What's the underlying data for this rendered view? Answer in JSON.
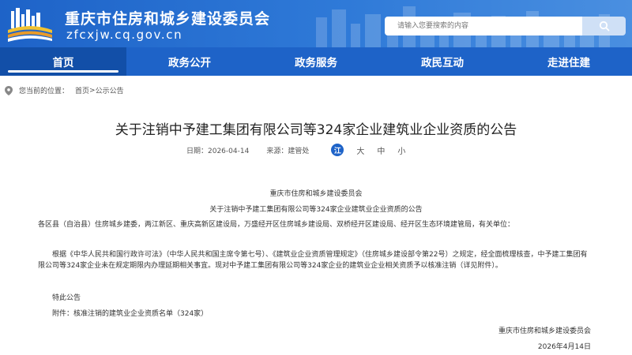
{
  "header": {
    "site_title": "重庆市住房和城乡建设委员会",
    "site_domain": "zfcxjw.cq.gov.cn",
    "search_placeholder": "请输入您要搜索的内容",
    "icons": [
      "emblem-logo-icon",
      "search-icon"
    ]
  },
  "nav": {
    "items": [
      "首页",
      "政务公开",
      "政务服务",
      "政民互动",
      "走进住建"
    ],
    "active": "首页"
  },
  "breadcrumb": {
    "prefix": "您当前的位置：",
    "home": "首页",
    "separator": ">",
    "current": "公示公告"
  },
  "article": {
    "title": "关于注销中予建工集团有限公司等324家企业建筑业企业资质的公告",
    "date": "日期：2026-04-14",
    "source": "来源：建管处",
    "font_icon": "江",
    "font_sizes": [
      "大",
      "中",
      "小"
    ],
    "org_header": "重庆市住房和城乡建设委员会",
    "doc_title": "关于注销中予建工集团有限公司等324家企业建筑业企业资质的公告",
    "recipients": "各区县（自治县）住房城乡建委，两江新区、重庆高新区建设局，万盛经开区住房城乡建设局、双桥经开区建设局、经开区生态环境建管局，有关单位：",
    "body": "根据《中华人民共和国行政许可法》（中华人民共和国主席令第七号）、《建筑业企业资质管理规定》（住房城乡建设部令第22号）之规定，经全面梳理核查，中予建工集团有限公司等324家企业未在规定期限内办理延期相关事宜。现对中予建工集团有限公司等324家企业的建筑业企业相关资质予以核准注销（详见附件）。",
    "notice": "特此公告",
    "attachment": "附件：核准注销的建筑业企业资质名单（324家）",
    "signature": "重庆市住房和城乡建设委员会",
    "sign_date": "2026年4月14日"
  },
  "colors": {
    "primary": "#1e63c8",
    "active_nav": "#124fa8",
    "text": "#333333"
  }
}
